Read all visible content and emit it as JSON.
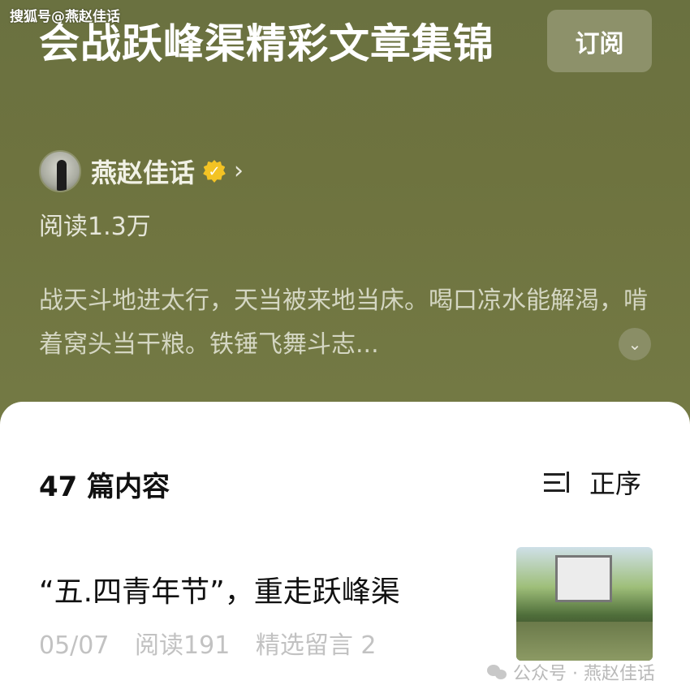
{
  "watermark_top": "搜狐号@燕赵佳话",
  "header": {
    "title": "会战跃峰渠精彩文章集锦",
    "subscribe_label": "订阅",
    "author_name": "燕赵佳话",
    "read_count": "阅读1.3万",
    "description": "战天斗地进太行，天当被来地当床。喝口凉水能解渴，啃着窝头当干粮。铁锤飞舞斗志..."
  },
  "list": {
    "count_label": "47 篇内容",
    "sort_label": "正序",
    "articles": [
      {
        "title": "“五.四青年节”，重走跃峰渠",
        "date": "05/07",
        "reads": "阅读191",
        "comments": "精选留言 2"
      }
    ]
  },
  "watermark_bottom": "公众号 · 燕赵佳话",
  "colors": {
    "header_bg": "#6c7240",
    "verified_badge": "#f3c324"
  },
  "icons": [
    "verified-badge-icon",
    "chevron-right-icon",
    "expand-down-icon",
    "sort-icon",
    "wechat-icon"
  ]
}
